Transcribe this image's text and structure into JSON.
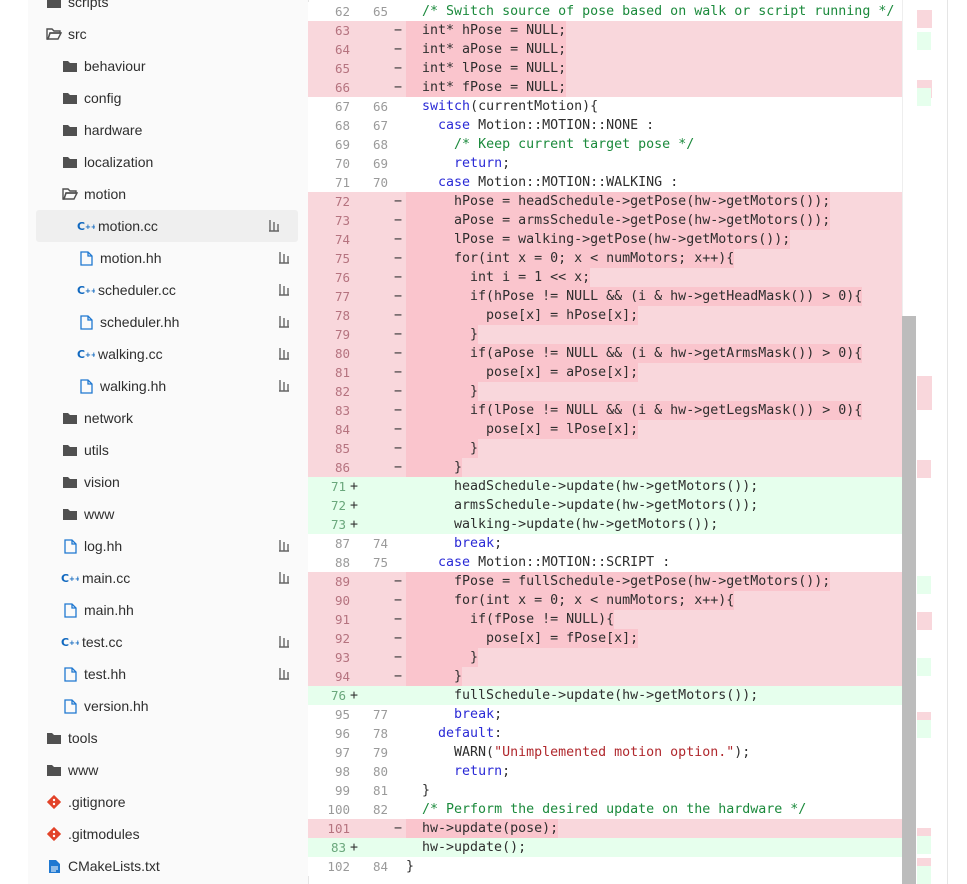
{
  "colors": {
    "del_bg": "#f9d7dc",
    "add_bg": "#e6ffed",
    "keyword": "#2a2ad6",
    "comment": "#1b8a3c",
    "string": "#b0282d",
    "cc_icon": "#1068bf"
  },
  "tree": [
    {
      "name": "scripts",
      "type": "folder",
      "depth": 0
    },
    {
      "name": "src",
      "type": "folder-open",
      "depth": 0
    },
    {
      "name": "behaviour",
      "type": "folder",
      "depth": 1
    },
    {
      "name": "config",
      "type": "folder",
      "depth": 1
    },
    {
      "name": "hardware",
      "type": "folder",
      "depth": 1
    },
    {
      "name": "localization",
      "type": "folder",
      "depth": 1
    },
    {
      "name": "motion",
      "type": "folder-open",
      "depth": 1
    },
    {
      "name": "motion.cc",
      "type": "cc",
      "depth": 2,
      "lfs": true,
      "active": true
    },
    {
      "name": "motion.hh",
      "type": "file",
      "depth": 2,
      "lfs": true
    },
    {
      "name": "scheduler.cc",
      "type": "cc",
      "depth": 2,
      "lfs": true
    },
    {
      "name": "scheduler.hh",
      "type": "file",
      "depth": 2,
      "lfs": true
    },
    {
      "name": "walking.cc",
      "type": "cc",
      "depth": 2,
      "lfs": true
    },
    {
      "name": "walking.hh",
      "type": "file",
      "depth": 2,
      "lfs": true
    },
    {
      "name": "network",
      "type": "folder",
      "depth": 1
    },
    {
      "name": "utils",
      "type": "folder",
      "depth": 1
    },
    {
      "name": "vision",
      "type": "folder",
      "depth": 1
    },
    {
      "name": "www",
      "type": "folder",
      "depth": 1
    },
    {
      "name": "log.hh",
      "type": "file",
      "depth": 1,
      "lfs": true
    },
    {
      "name": "main.cc",
      "type": "cc",
      "depth": 1,
      "lfs": true
    },
    {
      "name": "main.hh",
      "type": "file",
      "depth": 1
    },
    {
      "name": "test.cc",
      "type": "cc",
      "depth": 1,
      "lfs": true
    },
    {
      "name": "test.hh",
      "type": "file",
      "depth": 1,
      "lfs": true
    },
    {
      "name": "version.hh",
      "type": "file",
      "depth": 1
    },
    {
      "name": "tools",
      "type": "folder",
      "depth": 0
    },
    {
      "name": "www",
      "type": "folder",
      "depth": 0
    },
    {
      "name": ".gitignore",
      "type": "git",
      "depth": 0
    },
    {
      "name": ".gitmodules",
      "type": "git",
      "depth": 0
    },
    {
      "name": "CMakeLists.txt",
      "type": "doc",
      "depth": 0
    }
  ],
  "diff": [
    {
      "t": "ctx",
      "o": "62",
      "n": "65",
      "code": "  /* Switch source of pose based on walk or script running */"
    },
    {
      "t": "del",
      "o": "63",
      "n": "",
      "code": "  int* hPose = NULL;"
    },
    {
      "t": "del",
      "o": "64",
      "n": "",
      "code": "  int* aPose = NULL;"
    },
    {
      "t": "del",
      "o": "65",
      "n": "",
      "code": "  int* lPose = NULL;"
    },
    {
      "t": "del",
      "o": "66",
      "n": "",
      "code": "  int* fPose = NULL;"
    },
    {
      "t": "ctx",
      "o": "67",
      "n": "66",
      "code": "  switch(currentMotion){"
    },
    {
      "t": "ctx",
      "o": "68",
      "n": "67",
      "code": "    case Motion::MOTION::NONE :"
    },
    {
      "t": "ctx",
      "o": "69",
      "n": "68",
      "code": "      /* Keep current target pose */"
    },
    {
      "t": "ctx",
      "o": "70",
      "n": "69",
      "code": "      return;"
    },
    {
      "t": "ctx",
      "o": "71",
      "n": "70",
      "code": "    case Motion::MOTION::WALKING :"
    },
    {
      "t": "del",
      "o": "72",
      "n": "",
      "code": "      hPose = headSchedule->getPose(hw->getMotors());"
    },
    {
      "t": "del",
      "o": "73",
      "n": "",
      "code": "      aPose = armsSchedule->getPose(hw->getMotors());"
    },
    {
      "t": "del",
      "o": "74",
      "n": "",
      "code": "      lPose = walking->getPose(hw->getMotors());"
    },
    {
      "t": "del",
      "o": "75",
      "n": "",
      "code": "      for(int x = 0; x < numMotors; x++){"
    },
    {
      "t": "del",
      "o": "76",
      "n": "",
      "code": "        int i = 1 << x;"
    },
    {
      "t": "del",
      "o": "77",
      "n": "",
      "code": "        if(hPose != NULL && (i & hw->getHeadMask()) > 0){"
    },
    {
      "t": "del",
      "o": "78",
      "n": "",
      "code": "          pose[x] = hPose[x];"
    },
    {
      "t": "del",
      "o": "79",
      "n": "",
      "code": "        }"
    },
    {
      "t": "del",
      "o": "80",
      "n": "",
      "code": "        if(aPose != NULL && (i & hw->getArmsMask()) > 0){"
    },
    {
      "t": "del",
      "o": "81",
      "n": "",
      "code": "          pose[x] = aPose[x];"
    },
    {
      "t": "del",
      "o": "82",
      "n": "",
      "code": "        }"
    },
    {
      "t": "del",
      "o": "83",
      "n": "",
      "code": "        if(lPose != NULL && (i & hw->getLegsMask()) > 0){"
    },
    {
      "t": "del",
      "o": "84",
      "n": "",
      "code": "          pose[x] = lPose[x];"
    },
    {
      "t": "del",
      "o": "85",
      "n": "",
      "code": "        }"
    },
    {
      "t": "del",
      "o": "86",
      "n": "",
      "code": "      }"
    },
    {
      "t": "add",
      "o": "",
      "n": "71",
      "code": "      headSchedule->update(hw->getMotors());"
    },
    {
      "t": "add",
      "o": "",
      "n": "72",
      "code": "      armsSchedule->update(hw->getMotors());"
    },
    {
      "t": "add",
      "o": "",
      "n": "73",
      "code": "      walking->update(hw->getMotors());"
    },
    {
      "t": "ctx",
      "o": "87",
      "n": "74",
      "code": "      break;"
    },
    {
      "t": "ctx",
      "o": "88",
      "n": "75",
      "code": "    case Motion::MOTION::SCRIPT :"
    },
    {
      "t": "del",
      "o": "89",
      "n": "",
      "code": "      fPose = fullSchedule->getPose(hw->getMotors());"
    },
    {
      "t": "del",
      "o": "90",
      "n": "",
      "code": "      for(int x = 0; x < numMotors; x++){"
    },
    {
      "t": "del",
      "o": "91",
      "n": "",
      "code": "        if(fPose != NULL){"
    },
    {
      "t": "del",
      "o": "92",
      "n": "",
      "code": "          pose[x] = fPose[x];"
    },
    {
      "t": "del",
      "o": "93",
      "n": "",
      "code": "        }"
    },
    {
      "t": "del",
      "o": "94",
      "n": "",
      "code": "      }"
    },
    {
      "t": "add",
      "o": "",
      "n": "76",
      "code": "      fullSchedule->update(hw->getMotors());"
    },
    {
      "t": "ctx",
      "o": "95",
      "n": "77",
      "code": "      break;"
    },
    {
      "t": "ctx",
      "o": "96",
      "n": "78",
      "code": "    default:"
    },
    {
      "t": "ctx",
      "o": "97",
      "n": "79",
      "code": "      WARN(\"Unimplemented motion option.\");"
    },
    {
      "t": "ctx",
      "o": "98",
      "n": "80",
      "code": "      return;"
    },
    {
      "t": "ctx",
      "o": "99",
      "n": "81",
      "code": "  }"
    },
    {
      "t": "ctx",
      "o": "100",
      "n": "82",
      "code": "  /* Perform the desired update on the hardware */"
    },
    {
      "t": "del",
      "o": "101",
      "n": "",
      "code": "  hw->update(pose);"
    },
    {
      "t": "add",
      "o": "",
      "n": "83",
      "code": "  hw->update();"
    },
    {
      "t": "ctx",
      "o": "102",
      "n": "84",
      "code": "}"
    }
  ]
}
